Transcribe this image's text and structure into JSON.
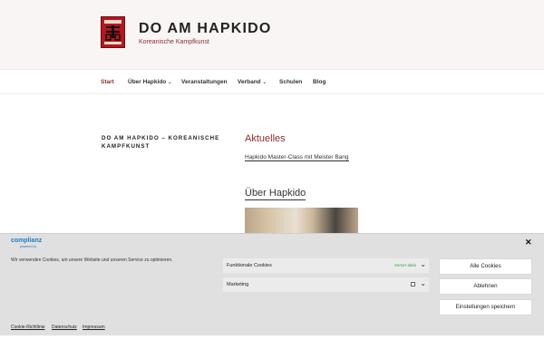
{
  "site": {
    "title": "DO AM HAPKIDO",
    "description": "Koreanische Kampfkunst",
    "logo_icon": "do-am-hapkido-emblem",
    "logo_color": "#b4171f"
  },
  "nav": {
    "items": [
      {
        "label": "Start",
        "active": true
      },
      {
        "label": "Über Hapkido",
        "dropdown": true
      },
      {
        "label": "Veranstaltungen"
      },
      {
        "label": "Verband",
        "dropdown": true
      },
      {
        "label": "Schulen"
      },
      {
        "label": "Blog"
      }
    ],
    "caret": "⌄"
  },
  "main": {
    "left_title": "DO AM HAPKIDO – KOREANISCHE KAMPFKUNST",
    "news_heading": "Aktuelles",
    "news_link": "Hapkido Master-Class mit Meister Bang",
    "about_heading": "Über Hapkido"
  },
  "cookie": {
    "brand": "complianz",
    "brand_sub": "powered by",
    "close": "✕",
    "message": "Wir verwenden Cookies, um unsere Website und unseren Service zu optimieren.",
    "categories": [
      {
        "name": "Funktionale Cookies",
        "status": "Immer aktiv",
        "chevron": "⌄"
      },
      {
        "name": "Marketing",
        "chevron": "⌄"
      }
    ],
    "buttons": {
      "accept": "Alle Cookies",
      "deny": "Ablehnen",
      "save": "Einstellungen speichern"
    },
    "links": [
      "Cookie-Richtlinie",
      "Datenschutz",
      "Impressum"
    ],
    "accent_color": "#1e7bc2"
  },
  "colors": {
    "accent": "#8c2d2d",
    "header_bg": "#f9f5f5",
    "banner_bg": "#e0e0e0"
  }
}
